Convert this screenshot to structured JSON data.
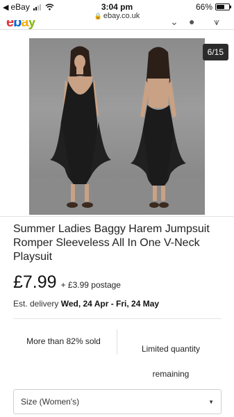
{
  "status_bar": {
    "back_app": "eBay",
    "time": "3:04 pm",
    "battery": "66%"
  },
  "browser": {
    "url": "ebay.co.uk"
  },
  "gallery": {
    "counter": "6/15"
  },
  "product": {
    "title": "Summer Ladies Baggy Harem Jumpsuit Romper Sleeveless All In One V-Neck Playsuit",
    "price": "£7.99",
    "postage": "+ £3.99 postage",
    "delivery_label": "Est. delivery",
    "delivery_dates": "Wed, 24 Apr - Fri, 24 May"
  },
  "stats": {
    "sold": "More than 82% sold",
    "quantity": "Limited quantity remaining"
  },
  "size_select": {
    "label": "Size (Women's)"
  }
}
